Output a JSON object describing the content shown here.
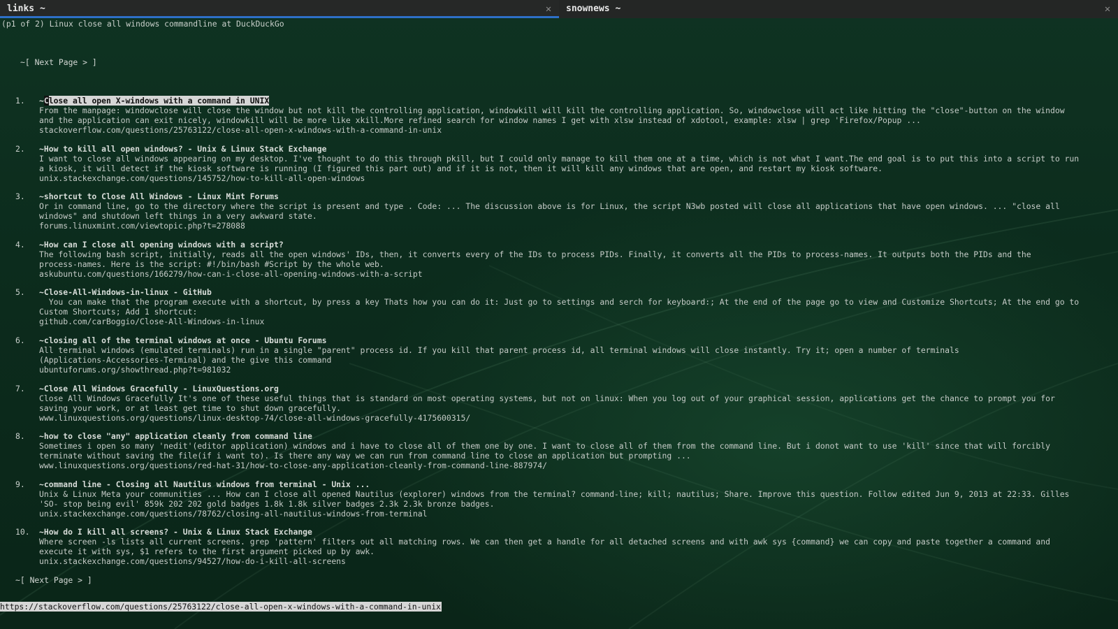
{
  "tabs": [
    {
      "label": "links  ~",
      "active": true,
      "close": "✕"
    },
    {
      "label": "snownews ~",
      "active": false,
      "close": "✕"
    }
  ],
  "page_header": "(p1 of 2) Linux close all windows commandline at DuckDuckGo",
  "next_page_top": "~[ Next Page > ]",
  "next_page_bottom": "~[ Next Page > ]",
  "results": [
    {
      "num": "1.",
      "title_first_char": "C",
      "title_rest": "lose all open X-windows with a command in UNIX",
      "snippet": [
        "From the manpage: windowclose will close the window but not kill the controlling application, windowkill will kill the controlling application. So, windowclose will act like hitting the \"close\"-button on the window",
        "and the application can exit nicely, windowkill will be more like xkill.More refined search for window names I get with xlsw instead of xdotool, example: xlsw | grep 'Firefox/Popup ..."
      ],
      "url": "stackoverflow.com/questions/25763122/close-all-open-x-windows-with-a-command-in-unix"
    },
    {
      "num": "2.",
      "title": "~How to kill all open windows? - Unix & Linux Stack Exchange",
      "snippet": [
        "I want to close all windows appearing on my desktop. I've thought to do this through pkill, but I could only manage to kill them one at a time, which is not what I want.The end goal is to put this into a script to run",
        "a kiosk, it will detect if the kiosk software is running (I figured this part out) and if it is not, then it will kill any windows that are open, and restart my kiosk software."
      ],
      "url": "unix.stackexchange.com/questions/145752/how-to-kill-all-open-windows"
    },
    {
      "num": "3.",
      "title": "~shortcut to Close All Windows - Linux Mint Forums",
      "snippet": [
        "Or in command line, go to the directory where the script is present and type . Code: ... The discussion above is for Linux, the script N3wb posted will close all applications that have open windows. ... \"close all",
        "windows\" and shutdown left things in a very awkward state."
      ],
      "url": "forums.linuxmint.com/viewtopic.php?t=278088"
    },
    {
      "num": "4.",
      "title": "~How can I close all opening windows with a script?",
      "snippet": [
        "The following bash script, initially, reads all the open windows' IDs, then, it converts every of the IDs to process PIDs. Finally, it converts all the PIDs to process-names. It outputs both the PIDs and the",
        "process-names. Here is the script: #!/bin/bash #Script by the whole web."
      ],
      "url": "askubuntu.com/questions/166279/how-can-i-close-all-opening-windows-with-a-script"
    },
    {
      "num": "5.",
      "title": "~Close-All-Windows-in-linux - GitHub",
      "snippet": [
        "  You can make that the program execute with a shortcut, by press a key Thats how you can do it: Just go to settings and serch for keyboard:; At the end of the page go to view and Customize Shortcuts; At the end go to",
        "Custom Shortcuts; Add 1 shortcut:"
      ],
      "url": "github.com/carBoggio/Close-All-Windows-in-linux"
    },
    {
      "num": "6.",
      "title": "~closing all of the terminal windows at once - Ubuntu Forums",
      "snippet": [
        "All terminal windows (emulated terminals) run in a single \"parent\" process id. If you kill that parent process id, all terminal windows will close instantly. Try it; open a number of terminals",
        "(Applications-Accessories-Terminal) and the give this command"
      ],
      "url": "ubuntuforums.org/showthread.php?t=981032"
    },
    {
      "num": "7.",
      "title": "~Close All Windows Gracefully - LinuxQuestions.org",
      "snippet": [
        "Close All Windows Gracefully It's one of these useful things that is standard on most operating systems, but not on linux: When you log out of your graphical session, applications get the chance to prompt you for",
        "saving your work, or at least get time to shut down gracefully."
      ],
      "url": "www.linuxquestions.org/questions/linux-desktop-74/close-all-windows-gracefully-4175600315/"
    },
    {
      "num": "8.",
      "title": "~how to close \"any\" application cleanly from command line",
      "snippet": [
        "Sometimes i open so many 'nedit'(editor application) windows and i have to close all of them one by one. I want to close all of them from the command line. But i donot want to use 'kill' since that will forcibly",
        "terminate without saving the file(if i want to). Is there any way we can run from command line to close an application but prompting ..."
      ],
      "url": "www.linuxquestions.org/questions/red-hat-31/how-to-close-any-application-cleanly-from-command-line-887974/"
    },
    {
      "num": "9.",
      "title": "~command line - Closing all Nautilus windows from terminal - Unix ...",
      "snippet": [
        "Unix & Linux Meta your communities ... How can I close all opened Nautilus (explorer) windows from the terminal? command-line; kill; nautilus; Share. Improve this question. Follow edited Jun 9, 2013 at 22:33. Gilles",
        "'SO- stop being evil' 859k 202 202 gold badges 1.8k 1.8k silver badges 2.3k 2.3k bronze badges."
      ],
      "url": "unix.stackexchange.com/questions/78762/closing-all-nautilus-windows-from-terminal"
    },
    {
      "num": "10.",
      "title": "~How do I kill all screens? - Unix & Linux Stack Exchange",
      "snippet": [
        "Where screen -ls lists all current screens. grep 'pattern' filters out all matching rows. We can then get a handle for all detached screens and with awk sys {command} we can copy and paste together a command and",
        "execute it with sys, $1 refers to the first argument picked up by awk."
      ],
      "url": "unix.stackexchange.com/questions/94527/how-do-i-kill-all-screens"
    }
  ],
  "status_url": "https://stackoverflow.com/questions/25763122/close-all-open-x-windows-with-a-command-in-unix"
}
